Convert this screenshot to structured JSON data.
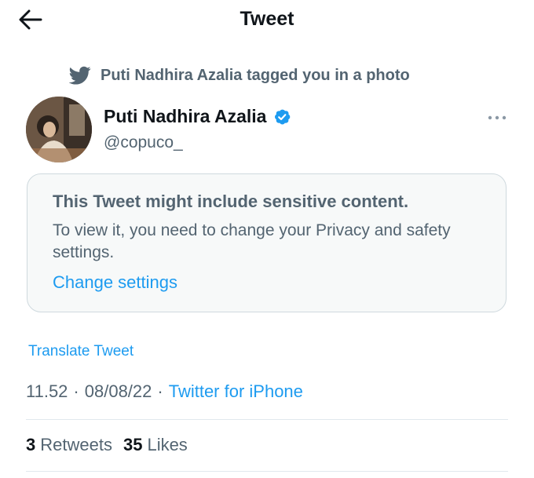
{
  "header": {
    "title": "Tweet",
    "back_icon": "arrow-left-icon"
  },
  "context": {
    "icon": "twitter-bird-icon",
    "text": "Puti Nadhira Azalia tagged you in a photo"
  },
  "author": {
    "name": "Puti Nadhira Azalia",
    "handle": "@copuco_",
    "verified": true,
    "verified_color": "#1d9bf0"
  },
  "warning": {
    "title": "This Tweet might include sensitive content.",
    "body": "To view it, you need to change your Privacy and safety settings.",
    "link": "Change settings"
  },
  "translate": "Translate Tweet",
  "meta": {
    "time": "11.52",
    "sep1": "·",
    "date": "08/08/22",
    "sep2": "·",
    "source": "Twitter for iPhone"
  },
  "stats": {
    "retweets_count": "3",
    "retweets_label": "Retweets",
    "likes_count": "35",
    "likes_label": "Likes"
  },
  "colors": {
    "accent": "#1d9bf0",
    "secondary_text": "#536471",
    "primary_text": "#0f1419"
  }
}
